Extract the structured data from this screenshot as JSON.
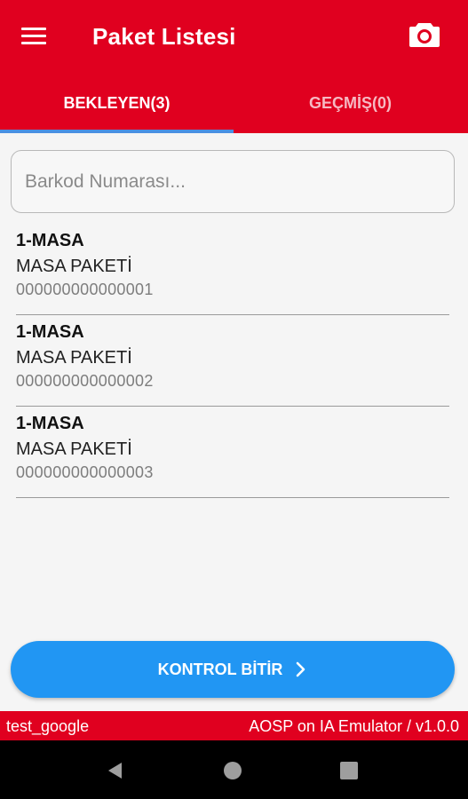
{
  "appbar": {
    "title": "Paket Listesi",
    "menu_icon": "menu-icon",
    "camera_icon": "camera-icon"
  },
  "tabs": [
    {
      "label": "BEKLEYEN(3)",
      "active": true
    },
    {
      "label": "GEÇMİŞ(0)",
      "active": false
    }
  ],
  "search": {
    "placeholder": "Barkod Numarası...",
    "value": ""
  },
  "packages": [
    {
      "title": "1-MASA",
      "name": "MASA PAKETİ",
      "code": "000000000000001"
    },
    {
      "title": "1-MASA",
      "name": "MASA PAKETİ",
      "code": "000000000000002"
    },
    {
      "title": "1-MASA",
      "name": "MASA PAKETİ",
      "code": "000000000000003"
    }
  ],
  "finish_button": {
    "label": "KONTROL BİTİR",
    "icon": "chevron-right-icon"
  },
  "status": {
    "left": "test_google",
    "right": "AOSP on IA Emulator / v1.0.0"
  },
  "colors": {
    "brand": "#e0001f",
    "accent": "#2196f3",
    "tab_indicator": "#4a90e2"
  }
}
